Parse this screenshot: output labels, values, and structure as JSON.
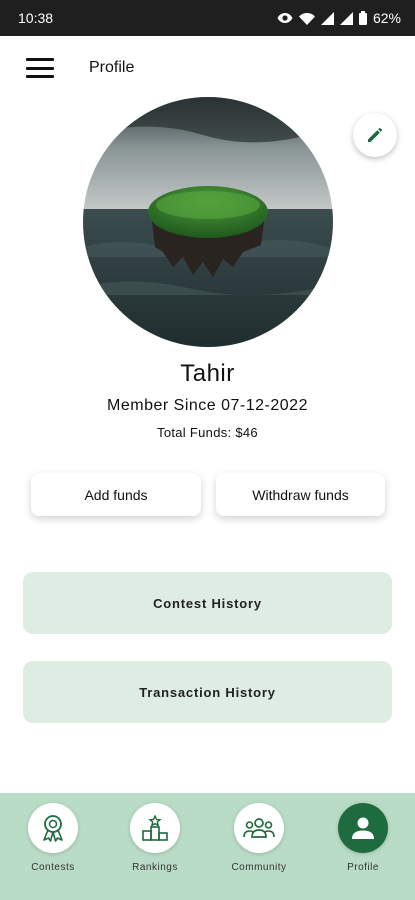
{
  "status_bar": {
    "time": "10:38",
    "battery": "62%"
  },
  "app_bar": {
    "title": "Profile"
  },
  "profile": {
    "name": "Tahir",
    "member_since": "Member Since 07-12-2022",
    "total_funds": "Total Funds: $46"
  },
  "actions": {
    "add_funds": "Add funds",
    "withdraw_funds": "Withdraw funds"
  },
  "history": {
    "contest": "Contest History",
    "transaction": "Transaction History"
  },
  "bottom_nav": {
    "items": [
      {
        "label": "Contests",
        "icon": "award-icon",
        "active": false
      },
      {
        "label": "Rankings",
        "icon": "podium-icon",
        "active": false
      },
      {
        "label": "Community",
        "icon": "group-icon",
        "active": false
      },
      {
        "label": "Profile",
        "icon": "person-icon",
        "active": true
      }
    ]
  },
  "colors": {
    "accent": "#1e6b3f",
    "nav_bg": "#b9dcc6",
    "card_bg": "#deece3"
  }
}
